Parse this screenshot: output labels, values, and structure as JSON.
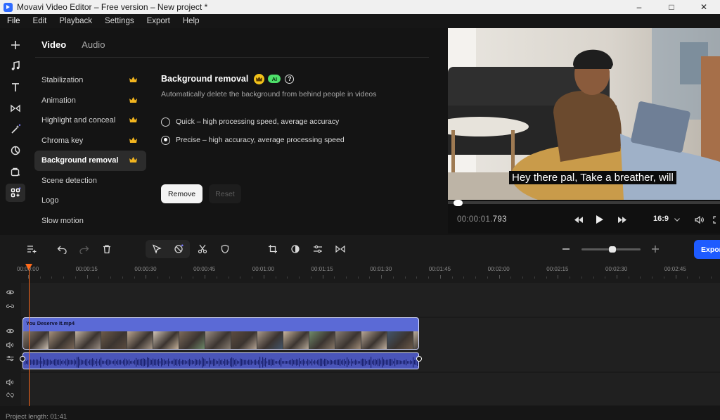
{
  "window": {
    "title": "Movavi Video Editor – Free version – New project *",
    "controls": {
      "minimize": "–",
      "maximize": "□",
      "close": "✕"
    }
  },
  "menu": [
    "File",
    "Edit",
    "Playback",
    "Settings",
    "Export",
    "Help"
  ],
  "rail": {
    "items": [
      "add-icon",
      "music-icon",
      "titles-icon",
      "transitions-icon",
      "effects-icon",
      "stickers-icon",
      "elements-icon",
      "more-tools-icon"
    ],
    "active": "more-tools-icon"
  },
  "panel": {
    "tabs": [
      {
        "label": "Video",
        "active": true
      },
      {
        "label": "Audio",
        "active": false
      }
    ],
    "categories": [
      {
        "label": "Stabilization",
        "premium": true,
        "active": false
      },
      {
        "label": "Animation",
        "premium": true,
        "active": false
      },
      {
        "label": "Highlight and conceal",
        "premium": true,
        "active": false
      },
      {
        "label": "Chroma key",
        "premium": true,
        "active": false
      },
      {
        "label": "Background removal",
        "premium": true,
        "active": true
      },
      {
        "label": "Scene detection",
        "premium": false,
        "active": false
      },
      {
        "label": "Logo",
        "premium": false,
        "active": false
      },
      {
        "label": "Slow motion",
        "premium": false,
        "active": false
      }
    ],
    "detail": {
      "title": "Background removal",
      "ai_badge": "AI",
      "help_icon": "?",
      "description": "Automatically delete the background from behind people in videos",
      "options": [
        {
          "label": "Quick – high processing speed, average accuracy",
          "selected": false
        },
        {
          "label": "Precise – high accuracy, average processing speed",
          "selected": true
        }
      ],
      "remove_label": "Remove",
      "reset_label": "Reset"
    }
  },
  "preview": {
    "caption": "Hey there pal, Take a breather, will",
    "timecode_dim": "00:00:01.",
    "timecode_bright": "793",
    "aspect_ratio": "16:9",
    "progress": 0.03
  },
  "toolbar": {
    "export_label": "Export",
    "zoom_level": 0.5
  },
  "timeline": {
    "ruler": [
      "00:00:00",
      "00:00:15",
      "00:00:30",
      "00:00:45",
      "00:01:00",
      "00:01:15",
      "00:01:30",
      "00:01:45",
      "00:02:00",
      "00:02:15",
      "00:02:30",
      "00:02:45"
    ],
    "clip_name": "You Deserve It.mp4",
    "accent": "#ff6a1a",
    "clip_color": "#5b6ad6"
  },
  "footer": {
    "project_length": "Project length: 01:41"
  }
}
